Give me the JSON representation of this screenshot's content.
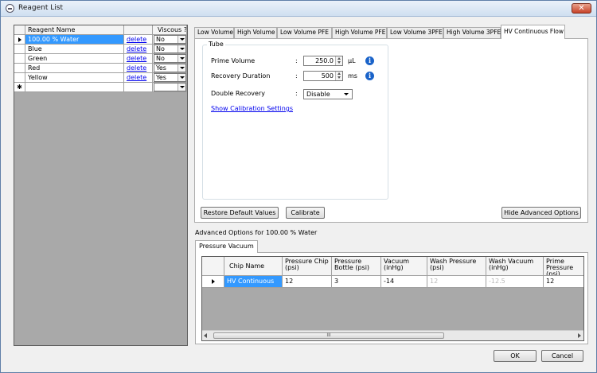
{
  "window": {
    "title": "Reagent List",
    "close_label": "✕"
  },
  "reagent_grid": {
    "headers": {
      "name": "Reagent Name",
      "viscous": "Viscous ?"
    },
    "new_row_marker": "✱",
    "rows": [
      {
        "name": "100.00 % Water",
        "delete": "delete",
        "viscous": "No",
        "selected": true
      },
      {
        "name": "Blue",
        "delete": "delete",
        "viscous": "No"
      },
      {
        "name": "Green",
        "delete": "delete",
        "viscous": "No"
      },
      {
        "name": "Red",
        "delete": "delete",
        "viscous": "Yes"
      },
      {
        "name": "Yellow",
        "delete": "delete",
        "viscous": "Yes"
      }
    ]
  },
  "tabs": {
    "items": [
      "Low Volume",
      "High Volume",
      "Low Volume PFE",
      "High Volume PFE",
      "Low Volume 3PFE",
      "High Volume 3PFE",
      "HV Continuous Flow"
    ],
    "active": "HV Continuous Flow"
  },
  "tube": {
    "legend": "Tube",
    "colon": ":",
    "prime_volume": {
      "label": "Prime Volume",
      "value": "250.0",
      "unit": "µL"
    },
    "recovery_duration": {
      "label": "Recovery Duration",
      "value": "500",
      "unit": "ms"
    },
    "double_recovery": {
      "label": "Double Recovery",
      "value": "Disable"
    },
    "calibration_link": "Show Calibration Settings"
  },
  "buttons": {
    "restore": "Restore Default Values",
    "calibrate": "Calibrate",
    "hide_advanced": "Hide Advanced Options",
    "ok": "OK",
    "cancel": "Cancel"
  },
  "advanced": {
    "caption": "Advanced Options for 100.00 % Water",
    "tab": "Pressure Vacuum",
    "headers": [
      "Chip Name",
      "Pressure Chip (psi)",
      "Pressure Bottle (psi)",
      "Vacuum (inHg)",
      "Wash Pressure (psi)",
      "Wash Vacuum (inHg)",
      "Prime Pressure (psi)"
    ],
    "row": [
      "HV Continuous R...",
      "12",
      "3",
      "-14",
      "12",
      "-12.5",
      "12"
    ],
    "scroll_grip": "III"
  },
  "icons": {
    "info": "i"
  },
  "colors": {
    "selection": "#3399ff",
    "link": "#0000ee",
    "info": "#1a63c9",
    "close": "#c7432a"
  }
}
